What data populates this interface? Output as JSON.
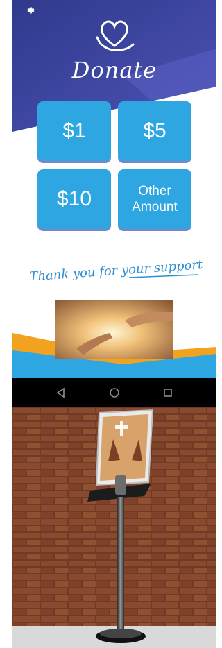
{
  "app": {
    "logo_text": "Donate",
    "buttons": [
      {
        "label": "$1"
      },
      {
        "label": "$5"
      },
      {
        "label": "$10"
      },
      {
        "label": "Other\nAmount"
      }
    ],
    "thanks_text": "Thank you for your support"
  },
  "icons": {
    "settings": "gear-icon",
    "back": "triangle-back-icon",
    "home": "circle-home-icon",
    "recents": "square-recents-icon"
  },
  "colors": {
    "hero_top": "#39429a",
    "hero_bottom": "#4a4fb0",
    "button": "#2ea6e2",
    "orange": "#f3a21f",
    "blue": "#2ea6e2",
    "navbar": "#000000",
    "brick": "#8a4a2f"
  }
}
